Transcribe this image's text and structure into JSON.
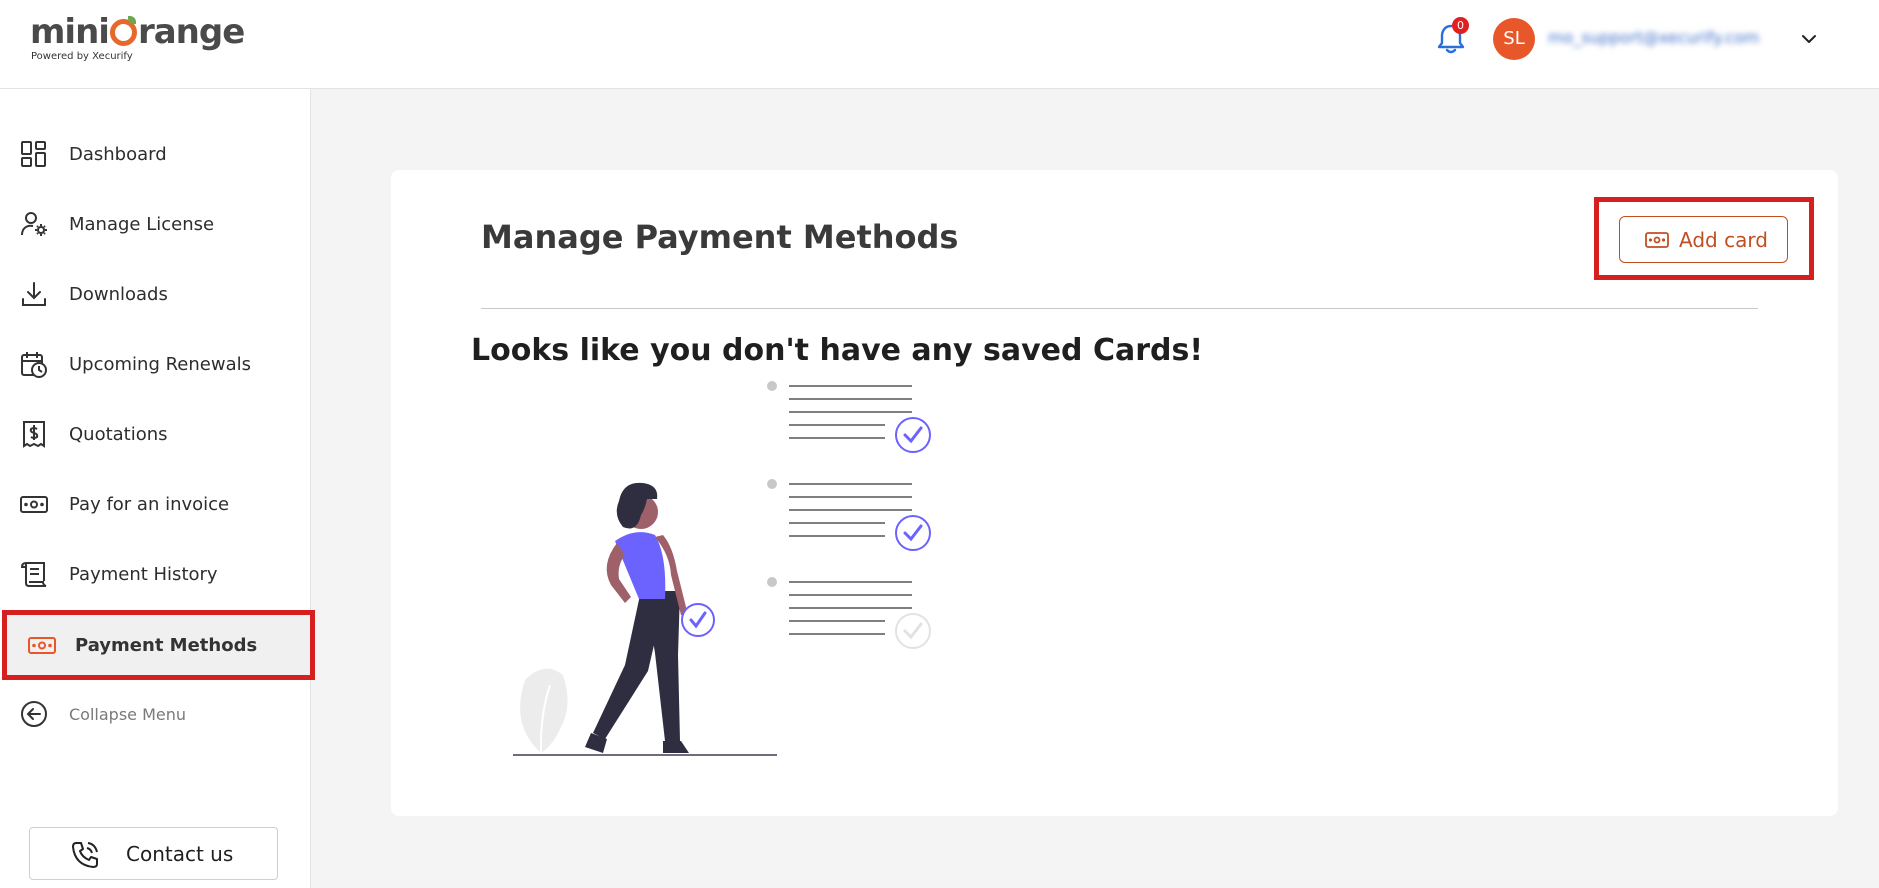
{
  "brand": {
    "name_part1": "mini",
    "name_part2": "range",
    "tagline": "Powered by Xecurify"
  },
  "header": {
    "notification_count": "0",
    "avatar_initials": "SL",
    "user_email": "mo_support@xecurify.com"
  },
  "sidebar": {
    "items": [
      {
        "label": "Dashboard",
        "icon": "dashboard-icon"
      },
      {
        "label": "Manage License",
        "icon": "user-settings-icon"
      },
      {
        "label": "Downloads",
        "icon": "download-icon"
      },
      {
        "label": "Upcoming Renewals",
        "icon": "calendar-clock-icon"
      },
      {
        "label": "Quotations",
        "icon": "dollar-receipt-icon"
      },
      {
        "label": "Pay for an invoice",
        "icon": "banknote-icon"
      },
      {
        "label": "Payment History",
        "icon": "scroll-icon"
      },
      {
        "label": "Payment Methods",
        "icon": "banknote-icon",
        "active": true
      },
      {
        "label": "Collapse Menu",
        "icon": "arrow-left-circle-icon"
      }
    ],
    "contact_label": "Contact us"
  },
  "main": {
    "title": "Manage Payment Methods",
    "add_card_label": "Add card",
    "empty_message": "Looks like you don't have any saved Cards!"
  },
  "colors": {
    "brand_orange": "#e8672a",
    "highlight_red": "#d61f1f",
    "accent_purple": "#6c63ff"
  }
}
